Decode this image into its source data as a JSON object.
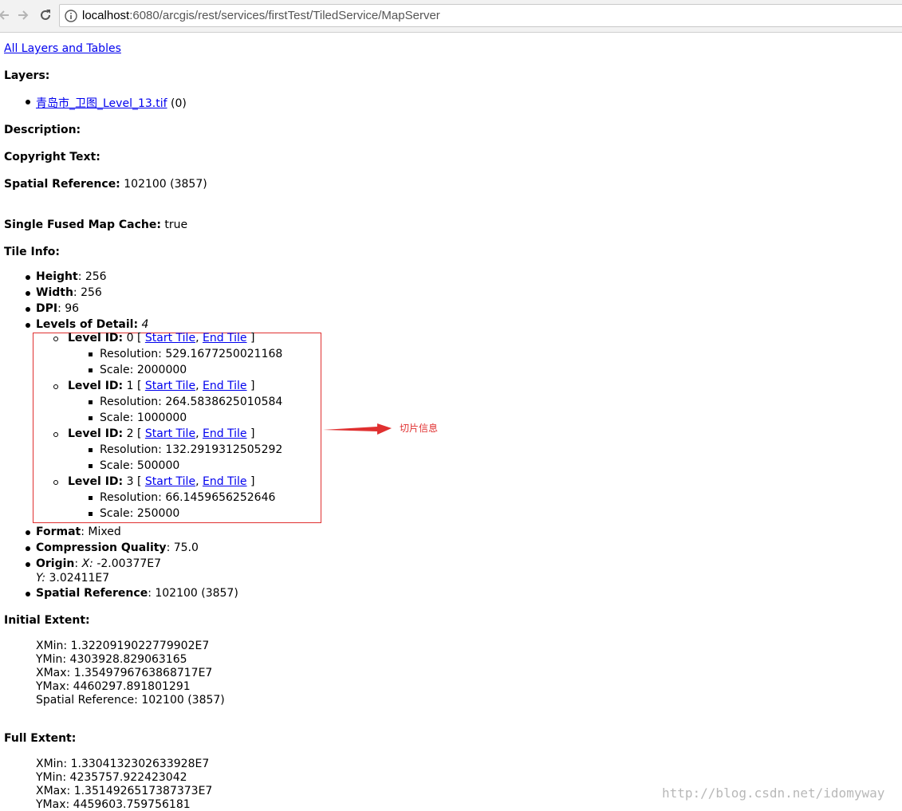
{
  "browser": {
    "url_host": "localhost",
    "url_rest": ":6080/arcgis/rest/services/firstTest/TiledService/MapServer"
  },
  "page": {
    "all_layers_link": "All Layers and Tables",
    "layers_label": "Layers:",
    "layer_name": "青岛市_卫图_Level_13.tif",
    "layer_id": "(0)",
    "description_label": "Description:",
    "copyright_label": "Copyright Text:",
    "spatial_ref_label": "Spatial Reference:",
    "spatial_ref_value": "102100  (3857)",
    "single_fused_label": "Single Fused Map Cache:",
    "single_fused_value": "true",
    "tile_info_label": "Tile Info:",
    "tile_info": {
      "height_label": "Height",
      "height_value": ": 256",
      "width_label": "Width",
      "width_value": ": 256",
      "dpi_label": "DPI",
      "dpi_value": ": 96",
      "lod_label": "Levels of Detail:",
      "lod_value": "4",
      "levels": [
        {
          "label": "Level ID:",
          "id": "0",
          "start": "Start Tile",
          "end": "End Tile",
          "resolution": "Resolution: 529.1677250021168",
          "scale": "Scale: 2000000"
        },
        {
          "label": "Level ID:",
          "id": "1",
          "start": "Start Tile",
          "end": "End Tile",
          "resolution": "Resolution: 264.5838625010584",
          "scale": "Scale: 1000000"
        },
        {
          "label": "Level ID:",
          "id": "2",
          "start": "Start Tile",
          "end": "End Tile",
          "resolution": "Resolution: 132.2919312505292",
          "scale": "Scale: 500000"
        },
        {
          "label": "Level ID:",
          "id": "3",
          "start": "Start Tile",
          "end": "End Tile",
          "resolution": "Resolution: 66.1459656252646",
          "scale": "Scale: 250000"
        }
      ],
      "format_label": "Format",
      "format_value": ": Mixed",
      "compression_label": "Compression Quality",
      "compression_value": ": 75.0",
      "origin_label": "Origin",
      "origin_x_label": "X:",
      "origin_x_value": "-2.00377E7",
      "origin_y_label": "Y:",
      "origin_y_value": "3.02411E7",
      "sr_label": "Spatial Reference",
      "sr_value": ": 102100  (3857)"
    },
    "annotation": "切片信息",
    "initial_extent_label": "Initial Extent:",
    "initial_extent": {
      "xmin": "XMin: 1.3220919022779902E7",
      "ymin": "YMin: 4303928.829063165",
      "xmax": "XMax: 1.3549796763868717E7",
      "ymax": "YMax: 4460297.891801291",
      "sr": "Spatial Reference: 102100  (3857)"
    },
    "full_extent_label": "Full Extent:",
    "full_extent": {
      "xmin": "XMin: 1.3304132302633928E7",
      "ymin": "YMin: 4235757.922423042",
      "xmax": "XMax: 1.3514926517387373E7",
      "ymax": "YMax: 4459603.759756181"
    },
    "watermark": "http://blog.csdn.net/idomyway"
  },
  "colors": {
    "link": "#0000ee",
    "annotation": "#e03030"
  }
}
